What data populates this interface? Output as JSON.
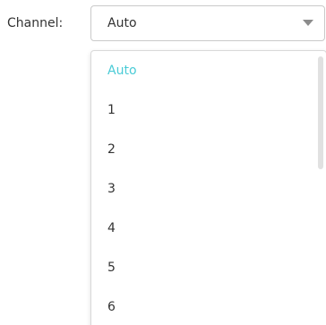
{
  "channel": {
    "label": "Channel:",
    "selected_value": "Auto",
    "arrow_icon": "triangle-down-icon",
    "options": [
      "Auto",
      "1",
      "2",
      "3",
      "4",
      "5",
      "6"
    ],
    "highlight_color": "#4acbd6"
  }
}
